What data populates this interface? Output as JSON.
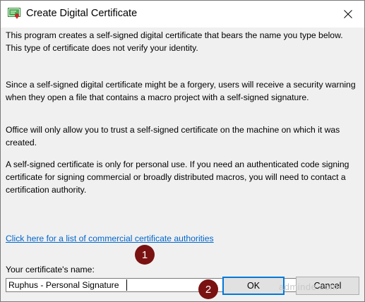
{
  "window": {
    "title": "Create Digital Certificate"
  },
  "content": {
    "paragraphs": [
      "This program creates a self-signed digital certificate that bears the name you type below. This type of certificate does not verify your identity.",
      "Since a self-signed digital certificate might be a forgery, users will receive a security warning when they open a file that contains a macro project with a self-signed signature.",
      "Office will only allow you to trust a self-signed certificate on the machine on which it was created.",
      "A self-signed certificate is only for personal use. If you need an authenticated code signing certificate for signing commercial or broadly distributed macros, you will need to contact a certification authority."
    ],
    "link_text": "Click here for a list of commercial certificate authorities"
  },
  "form": {
    "label": "Your certificate's name:",
    "value": "Ruphus - Personal Signature"
  },
  "buttons": {
    "ok": "OK",
    "cancel": "Cancel"
  },
  "annotations": {
    "step1": "1",
    "step2": "2",
    "color": "#7a1212"
  },
  "watermark": "adminde.com"
}
